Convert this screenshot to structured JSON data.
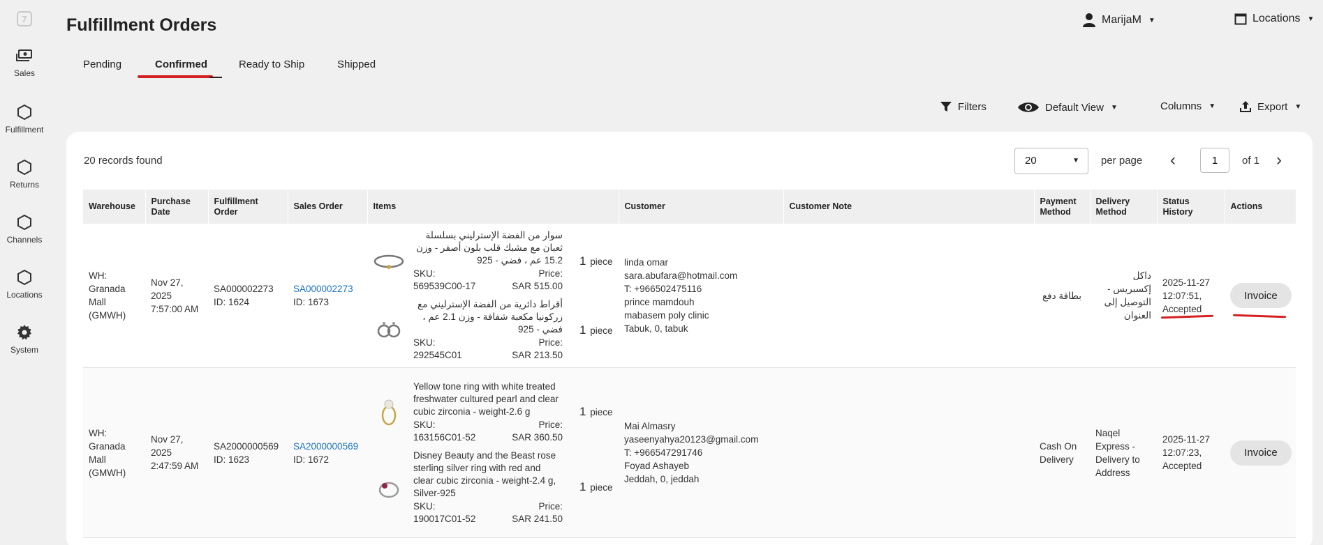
{
  "app": {
    "logo_glyph": "7"
  },
  "sidebar": {
    "items": [
      {
        "label": "Sales",
        "icon": "cash-icon"
      },
      {
        "label": "Fulfillment",
        "icon": "hexagon-icon"
      },
      {
        "label": "Returns",
        "icon": "hexagon-icon"
      },
      {
        "label": "Channels",
        "icon": "hexagon-icon"
      },
      {
        "label": "Locations",
        "icon": "hexagon-icon"
      },
      {
        "label": "System",
        "icon": "gear-icon"
      }
    ]
  },
  "header": {
    "title": "Fulfillment Orders",
    "user": "MarijaM",
    "locations": "Locations"
  },
  "tabs": [
    {
      "label": "Pending",
      "active": false
    },
    {
      "label": "Confirmed",
      "active": true
    },
    {
      "label": "Ready to Ship",
      "active": false
    },
    {
      "label": "Shipped",
      "active": false
    }
  ],
  "toolbar": {
    "filters": "Filters",
    "view": "Default View",
    "columns": "Columns",
    "export": "Export"
  },
  "list": {
    "records": "20 records found",
    "per_page_value": "20",
    "per_page_label": "per page",
    "page": "1",
    "of_pages": "of 1"
  },
  "columns": [
    "Warehouse",
    "Purchase Date",
    "Fulfillment Order",
    "Sales Order",
    "Items",
    "Customer",
    "Customer Note",
    "Payment Method",
    "Delivery Method",
    "Status History",
    "Actions"
  ],
  "rows": [
    {
      "warehouse": "WH: Granada Mall (GMWH)",
      "purchase_date": "Nov 27, 2025 7:57:00 AM",
      "fo_number": "SA000002273",
      "fo_id": "ID: 1624",
      "so_number": "SA000002273",
      "so_id": "ID: 1673",
      "items": [
        {
          "name": "سوار من الفضة الإسترليني بسلسلة ثعبان مع مشبك قلب بلون أصفر - وزن 15.2 عم ، فضي - 925",
          "sku_label": "SKU:",
          "sku": "569539C00-17",
          "price_label": "Price:",
          "price": "SAR 515.00",
          "qty": "1",
          "unit": "piece"
        },
        {
          "name": "أقراط دائرية من الفضة الإسترليني مع زركونيا مكعبة شفافة - وزن 2.1 عم ، فضي - 925",
          "sku_label": "SKU:",
          "sku": "292545C01",
          "price_label": "Price:",
          "price": "SAR 213.50",
          "qty": "1",
          "unit": "piece"
        }
      ],
      "customer": [
        "linda omar",
        "sara.abufara@hotmail.com",
        "T: +966502475116",
        "prince mamdouh",
        "mabasem poly clinic",
        "Tabuk, 0, tabuk"
      ],
      "note": "",
      "payment": "بطاقة دفع",
      "delivery": "داكل إكسبريس - التوصيل إلى العنوان",
      "status": "2025-11-27 12:07:51, Accepted",
      "action": "Invoice"
    },
    {
      "warehouse": "WH: Granada Mall (GMWH)",
      "purchase_date": "Nov 27, 2025 2:47:59 AM",
      "fo_number": "SA2000000569",
      "fo_id": "ID: 1623",
      "so_number": "SA2000000569",
      "so_id": "ID: 1672",
      "items": [
        {
          "name": "Yellow tone ring with white treated freshwater cultured pearl and clear cubic zirconia - weight-2.6 g",
          "sku_label": "SKU:",
          "sku": "163156C01-52",
          "price_label": "Price:",
          "price": "SAR 360.50",
          "qty": "1",
          "unit": "piece"
        },
        {
          "name": "Disney Beauty and the Beast rose sterling silver ring with red and clear cubic zirconia - weight-2.4 g, Silver-925",
          "sku_label": "SKU:",
          "sku": "190017C01-52",
          "price_label": "Price:",
          "price": "SAR 241.50",
          "qty": "1",
          "unit": "piece"
        }
      ],
      "customer": [
        "Mai Almasry",
        "yaseenyahya20123@gmail.com",
        "T: +966547291746",
        "Foyad Ashayeb",
        "Jeddah, 0, jeddah"
      ],
      "note": "",
      "payment": "Cash On Delivery",
      "delivery": "Naqel Express - Delivery to Address",
      "status": "2025-11-27 12:07:23, Accepted",
      "action": "Invoice"
    }
  ],
  "colors": {
    "link": "#1a73c8",
    "annotation": "#d42020"
  }
}
